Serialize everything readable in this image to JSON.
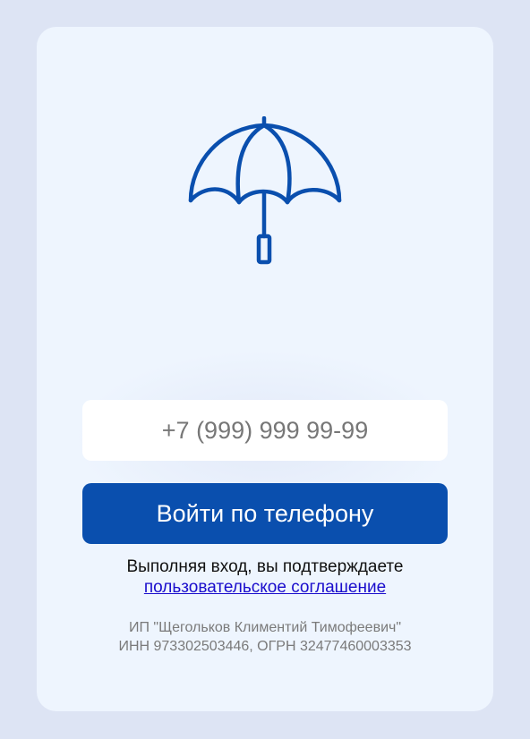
{
  "logo": {
    "icon": "umbrella-icon",
    "color": "#0a4fae"
  },
  "form": {
    "phone_placeholder": "+7 (999) 999 99-99",
    "phone_value": "",
    "login_button_label": "Войти по телефону",
    "accent_color": "#0a4fae"
  },
  "consent": {
    "text": "Выполняя вход, вы подтверждаете",
    "link_label": "пользовательское соглашение"
  },
  "legal": {
    "company": "ИП \"Щегольков Климентий Тимофеевич\"",
    "registration": "ИНН 973302503446, ОГРН 32477460003353"
  }
}
